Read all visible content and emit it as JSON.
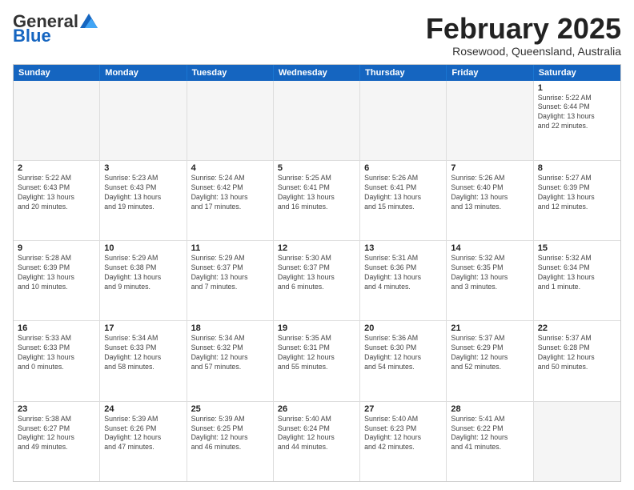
{
  "header": {
    "logo_general": "General",
    "logo_blue": "Blue",
    "month_title": "February 2025",
    "subtitle": "Rosewood, Queensland, Australia"
  },
  "weekdays": [
    "Sunday",
    "Monday",
    "Tuesday",
    "Wednesday",
    "Thursday",
    "Friday",
    "Saturday"
  ],
  "rows": [
    [
      {
        "day": "",
        "info": ""
      },
      {
        "day": "",
        "info": ""
      },
      {
        "day": "",
        "info": ""
      },
      {
        "day": "",
        "info": ""
      },
      {
        "day": "",
        "info": ""
      },
      {
        "day": "",
        "info": ""
      },
      {
        "day": "1",
        "info": "Sunrise: 5:22 AM\nSunset: 6:44 PM\nDaylight: 13 hours\nand 22 minutes."
      }
    ],
    [
      {
        "day": "2",
        "info": "Sunrise: 5:22 AM\nSunset: 6:43 PM\nDaylight: 13 hours\nand 20 minutes."
      },
      {
        "day": "3",
        "info": "Sunrise: 5:23 AM\nSunset: 6:43 PM\nDaylight: 13 hours\nand 19 minutes."
      },
      {
        "day": "4",
        "info": "Sunrise: 5:24 AM\nSunset: 6:42 PM\nDaylight: 13 hours\nand 17 minutes."
      },
      {
        "day": "5",
        "info": "Sunrise: 5:25 AM\nSunset: 6:41 PM\nDaylight: 13 hours\nand 16 minutes."
      },
      {
        "day": "6",
        "info": "Sunrise: 5:26 AM\nSunset: 6:41 PM\nDaylight: 13 hours\nand 15 minutes."
      },
      {
        "day": "7",
        "info": "Sunrise: 5:26 AM\nSunset: 6:40 PM\nDaylight: 13 hours\nand 13 minutes."
      },
      {
        "day": "8",
        "info": "Sunrise: 5:27 AM\nSunset: 6:39 PM\nDaylight: 13 hours\nand 12 minutes."
      }
    ],
    [
      {
        "day": "9",
        "info": "Sunrise: 5:28 AM\nSunset: 6:39 PM\nDaylight: 13 hours\nand 10 minutes."
      },
      {
        "day": "10",
        "info": "Sunrise: 5:29 AM\nSunset: 6:38 PM\nDaylight: 13 hours\nand 9 minutes."
      },
      {
        "day": "11",
        "info": "Sunrise: 5:29 AM\nSunset: 6:37 PM\nDaylight: 13 hours\nand 7 minutes."
      },
      {
        "day": "12",
        "info": "Sunrise: 5:30 AM\nSunset: 6:37 PM\nDaylight: 13 hours\nand 6 minutes."
      },
      {
        "day": "13",
        "info": "Sunrise: 5:31 AM\nSunset: 6:36 PM\nDaylight: 13 hours\nand 4 minutes."
      },
      {
        "day": "14",
        "info": "Sunrise: 5:32 AM\nSunset: 6:35 PM\nDaylight: 13 hours\nand 3 minutes."
      },
      {
        "day": "15",
        "info": "Sunrise: 5:32 AM\nSunset: 6:34 PM\nDaylight: 13 hours\nand 1 minute."
      }
    ],
    [
      {
        "day": "16",
        "info": "Sunrise: 5:33 AM\nSunset: 6:33 PM\nDaylight: 13 hours\nand 0 minutes."
      },
      {
        "day": "17",
        "info": "Sunrise: 5:34 AM\nSunset: 6:33 PM\nDaylight: 12 hours\nand 58 minutes."
      },
      {
        "day": "18",
        "info": "Sunrise: 5:34 AM\nSunset: 6:32 PM\nDaylight: 12 hours\nand 57 minutes."
      },
      {
        "day": "19",
        "info": "Sunrise: 5:35 AM\nSunset: 6:31 PM\nDaylight: 12 hours\nand 55 minutes."
      },
      {
        "day": "20",
        "info": "Sunrise: 5:36 AM\nSunset: 6:30 PM\nDaylight: 12 hours\nand 54 minutes."
      },
      {
        "day": "21",
        "info": "Sunrise: 5:37 AM\nSunset: 6:29 PM\nDaylight: 12 hours\nand 52 minutes."
      },
      {
        "day": "22",
        "info": "Sunrise: 5:37 AM\nSunset: 6:28 PM\nDaylight: 12 hours\nand 50 minutes."
      }
    ],
    [
      {
        "day": "23",
        "info": "Sunrise: 5:38 AM\nSunset: 6:27 PM\nDaylight: 12 hours\nand 49 minutes."
      },
      {
        "day": "24",
        "info": "Sunrise: 5:39 AM\nSunset: 6:26 PM\nDaylight: 12 hours\nand 47 minutes."
      },
      {
        "day": "25",
        "info": "Sunrise: 5:39 AM\nSunset: 6:25 PM\nDaylight: 12 hours\nand 46 minutes."
      },
      {
        "day": "26",
        "info": "Sunrise: 5:40 AM\nSunset: 6:24 PM\nDaylight: 12 hours\nand 44 minutes."
      },
      {
        "day": "27",
        "info": "Sunrise: 5:40 AM\nSunset: 6:23 PM\nDaylight: 12 hours\nand 42 minutes."
      },
      {
        "day": "28",
        "info": "Sunrise: 5:41 AM\nSunset: 6:22 PM\nDaylight: 12 hours\nand 41 minutes."
      },
      {
        "day": "",
        "info": ""
      }
    ]
  ]
}
